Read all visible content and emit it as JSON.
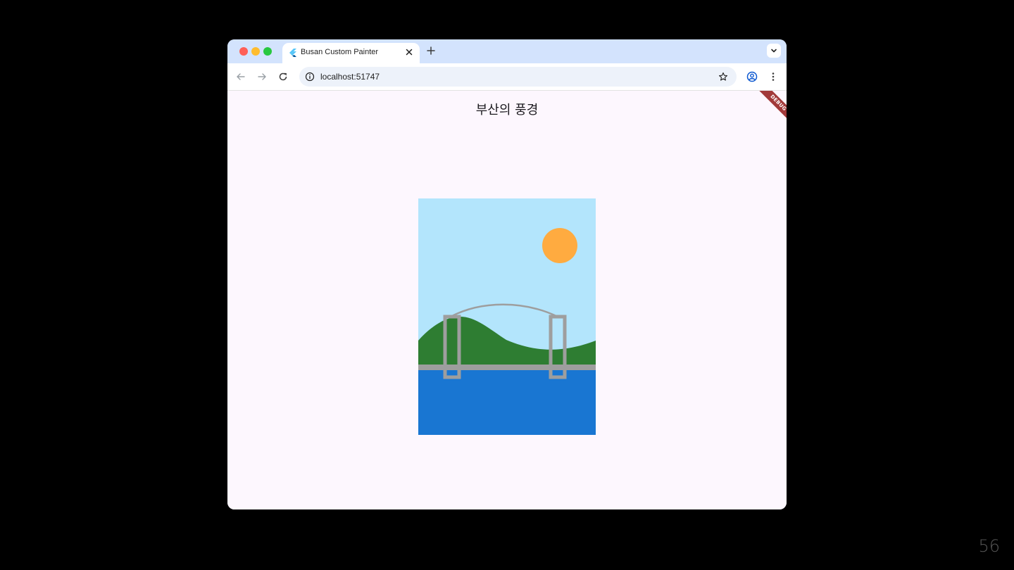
{
  "browser": {
    "tab_title": "Busan Custom Painter",
    "url": "localhost:51747"
  },
  "app": {
    "title": "부산의 풍경",
    "debug_banner": "DEBUG"
  },
  "slide": {
    "number": "56"
  },
  "icons": {
    "favicon": "flutter-logo-icon",
    "close": "close-icon",
    "new_tab": "plus-icon",
    "tab_search": "chevron-down-icon",
    "back": "arrow-left-icon",
    "forward": "arrow-right-icon",
    "reload": "reload-icon",
    "site_info": "info-icon",
    "bookmark": "star-icon",
    "profile": "profile-icon",
    "menu": "kebab-icon"
  },
  "colors": {
    "tabstrip": "#d3e3fd",
    "sky": "#b3e5fc",
    "sun": "#ffab40",
    "hills": "#2e7d32",
    "sea": "#1976d2",
    "bridge": "#9e9e9e",
    "page_background": "#fdf7fe"
  }
}
